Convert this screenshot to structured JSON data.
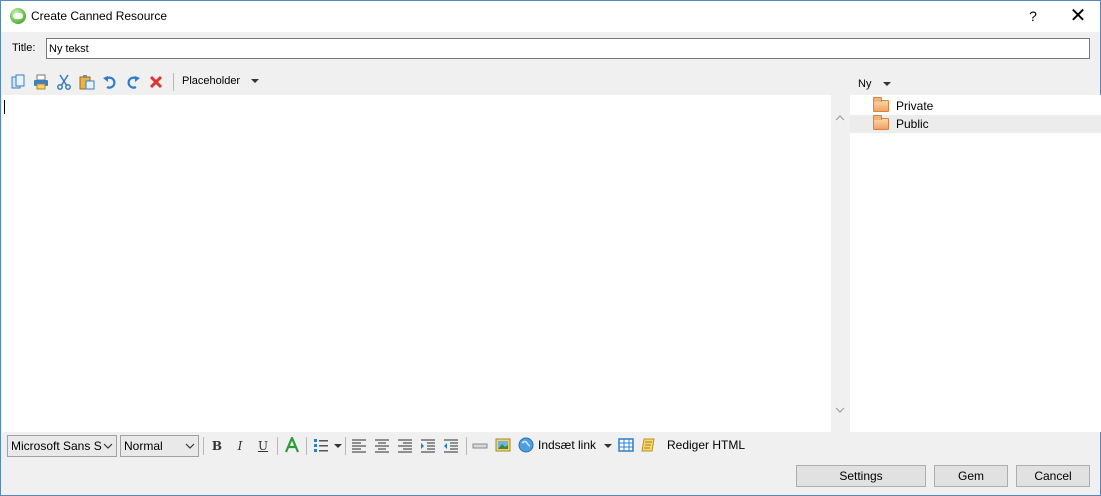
{
  "window": {
    "title": "Create Canned Resource",
    "help": "?",
    "close": "✕"
  },
  "title_row": {
    "label": "Title:",
    "value": "Ny tekst"
  },
  "toolbar": {
    "placeholder_label": "Placeholder"
  },
  "tree_panel": {
    "new_label": "Ny",
    "items": [
      {
        "label": "Private",
        "selected": false
      },
      {
        "label": "Public",
        "selected": true
      }
    ]
  },
  "format_bar": {
    "font_family": "Microsoft Sans S",
    "font_size": "Normal",
    "bold": "B",
    "italic": "I",
    "underline": "U",
    "insert_link": "Indsæt link",
    "edit_html": "Rediger HTML"
  },
  "buttons": {
    "settings": "Settings",
    "save": "Gem",
    "cancel": "Cancel"
  }
}
